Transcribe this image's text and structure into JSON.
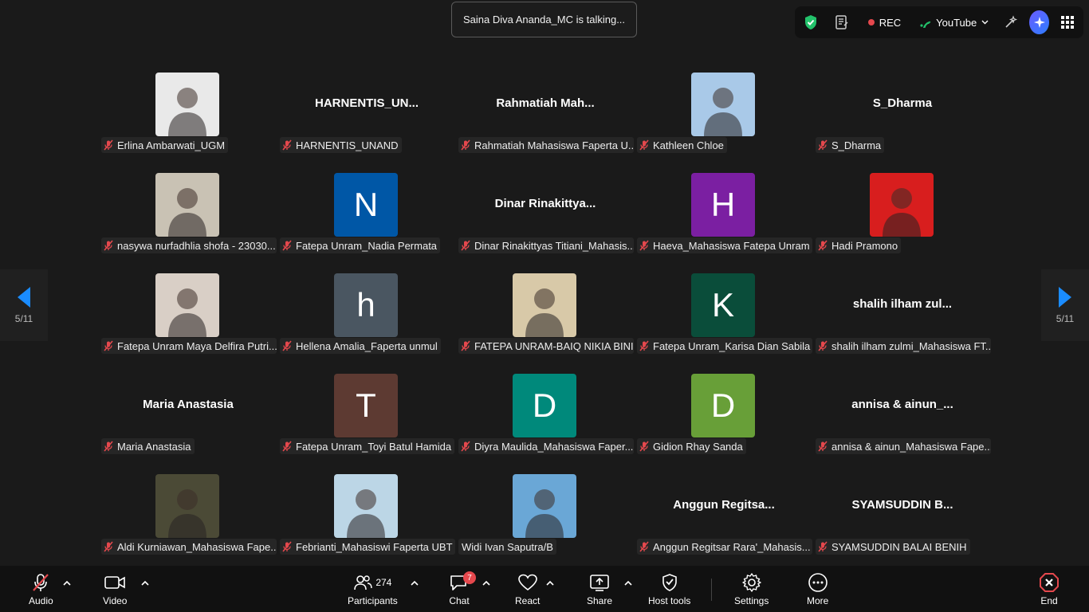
{
  "talking_banner": "Saina Diva Ananda_MC is talking...",
  "topbar": {
    "rec_label": "REC",
    "stream_label": "YouTube"
  },
  "pagination": {
    "left": "5/11",
    "right": "5/11"
  },
  "participants": [
    {
      "label": "Erlina Ambarwati_UGM",
      "avatar_type": "photo",
      "bg": "#e9e9e9"
    },
    {
      "label": "HARNENTIS_UNAND",
      "avatar_type": "name",
      "display": "HARNENTIS_UN..."
    },
    {
      "label": "Rahmatiah Mahasiswa Faperta U...",
      "avatar_type": "name",
      "display": "Rahmatiah  Mah..."
    },
    {
      "label": "Kathleen Chloe",
      "avatar_type": "photo",
      "bg": "#a9c9e8"
    },
    {
      "label": "S_Dharma",
      "avatar_type": "name",
      "display": "S_Dharma"
    },
    {
      "label": "nasywa nurfadhlia shofa - 23030...",
      "avatar_type": "photo",
      "bg": "#c9c2b4"
    },
    {
      "label": "Fatepa Unram_Nadia Permata",
      "avatar_type": "letter",
      "letter": "N",
      "bg": "#0057a6"
    },
    {
      "label": "Dinar Rinakittyas Titiani_Mahasis...",
      "avatar_type": "name",
      "display": "Dinar  Rinakittya..."
    },
    {
      "label": "Haeva_Mahasiswa Fatepa Unram",
      "avatar_type": "letter",
      "letter": "H",
      "bg": "#7b1fa2"
    },
    {
      "label": "Hadi Pramono",
      "avatar_type": "photo",
      "bg": "#d81e1e"
    },
    {
      "label": "Fatepa Unram Maya Delfira Putri...",
      "avatar_type": "photo",
      "bg": "#d9cfc6"
    },
    {
      "label": "Hellena Amalia_Faperta unmul",
      "avatar_type": "letter",
      "letter": "h",
      "bg": "#4a5661"
    },
    {
      "label": "FATEPA UNRAM-BAIQ NIKIA BINI...",
      "avatar_type": "photo",
      "bg": "#d8c9a8"
    },
    {
      "label": "Fatepa Unram_Karisa Dian Sabila",
      "avatar_type": "letter",
      "letter": "K",
      "bg": "#0a4d3a"
    },
    {
      "label": "shalih ilham zulmi_Mahasiswa FT...",
      "avatar_type": "name",
      "display": "shalih  ilham  zul..."
    },
    {
      "label": "Maria Anastasia",
      "avatar_type": "name",
      "display": "Maria Anastasia"
    },
    {
      "label": "Fatepa Unram_Toyi Batul Hamida",
      "avatar_type": "letter",
      "letter": "T",
      "bg": "#5d3a32"
    },
    {
      "label": "Diyra Maulida_Mahasiswa Faper...",
      "avatar_type": "letter",
      "letter": "D",
      "bg": "#00897b"
    },
    {
      "label": "Gidion Rhay Sanda",
      "avatar_type": "letter",
      "letter": "D",
      "bg": "#689f38"
    },
    {
      "label": "annisa & ainun_Mahasiswa Fape...",
      "avatar_type": "name",
      "display": "annisa  &  ainun_..."
    },
    {
      "label": "Aldi Kurniawan_Mahasiswa Fape...",
      "avatar_type": "photo",
      "bg": "#4b4a36"
    },
    {
      "label": "Febrianti_Mahasiswi Faperta UBT",
      "avatar_type": "photo",
      "bg": "#bcd6e6"
    },
    {
      "label": "Widi Ivan Saputra/B",
      "avatar_type": "photo",
      "bg": "#6aa7d6",
      "nomute": true
    },
    {
      "label": "Anggun Regitsar Rara'_Mahasis...",
      "avatar_type": "name",
      "display": "Anggun  Regitsa..."
    },
    {
      "label": "SYAMSUDDIN BALAI BENIH",
      "avatar_type": "name",
      "display": "SYAMSUDDIN  B..."
    }
  ],
  "toolbar": {
    "audio": "Audio",
    "video": "Video",
    "participants": "Participants",
    "participants_count": "274",
    "chat": "Chat",
    "chat_badge": "7",
    "react": "React",
    "share": "Share",
    "host_tools": "Host tools",
    "settings": "Settings",
    "more": "More",
    "end": "End"
  }
}
